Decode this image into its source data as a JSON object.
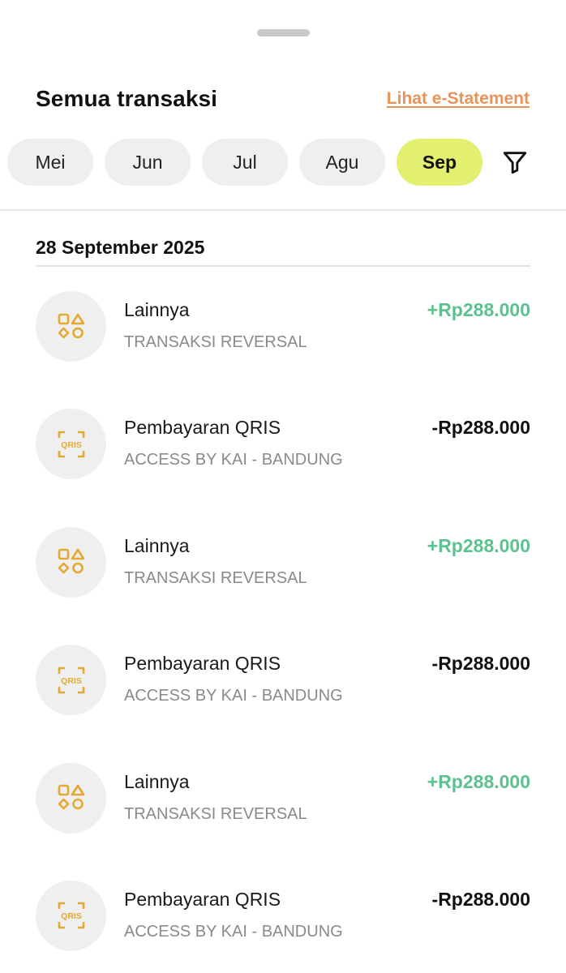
{
  "header": {
    "title": "Semua transaksi",
    "estatement_label": "Lihat e-Statement"
  },
  "months": [
    {
      "label": "Mei",
      "active": false
    },
    {
      "label": "Jun",
      "active": false
    },
    {
      "label": "Jul",
      "active": false
    },
    {
      "label": "Agu",
      "active": false
    },
    {
      "label": "Sep",
      "active": true
    }
  ],
  "filter": {
    "icon": "filter-icon"
  },
  "date_group": "28 September 2025",
  "colors": {
    "accent_link": "#e8935a",
    "active_chip": "#e3ef6e",
    "credit": "#5cc18f",
    "icon_gold": "#e3a932"
  },
  "transactions": [
    {
      "title": "Lainnya",
      "subtitle": "TRANSAKSI REVERSAL",
      "amount": "+Rp288.000",
      "type": "credit",
      "icon": "shapes-icon"
    },
    {
      "title": "Pembayaran QRIS",
      "subtitle": "ACCESS BY KAI - BANDUNG",
      "amount": "-Rp288.000",
      "type": "debit",
      "icon": "qris-icon",
      "icon_text": "QRIS"
    },
    {
      "title": "Lainnya",
      "subtitle": "TRANSAKSI REVERSAL",
      "amount": "+Rp288.000",
      "type": "credit",
      "icon": "shapes-icon"
    },
    {
      "title": "Pembayaran QRIS",
      "subtitle": "ACCESS BY KAI - BANDUNG",
      "amount": "-Rp288.000",
      "type": "debit",
      "icon": "qris-icon",
      "icon_text": "QRIS"
    },
    {
      "title": "Lainnya",
      "subtitle": "TRANSAKSI REVERSAL",
      "amount": "+Rp288.000",
      "type": "credit",
      "icon": "shapes-icon"
    },
    {
      "title": "Pembayaran QRIS",
      "subtitle": "ACCESS BY KAI - BANDUNG",
      "amount": "-Rp288.000",
      "type": "debit",
      "icon": "qris-icon",
      "icon_text": "QRIS"
    }
  ]
}
